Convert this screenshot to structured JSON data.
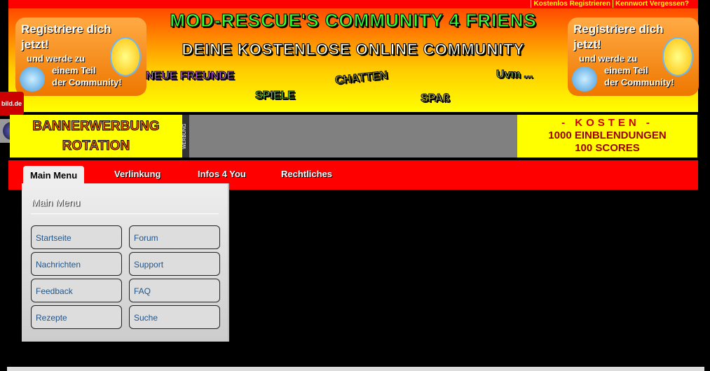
{
  "top_links": [
    "Kostenlos Registrieren",
    "Kennwort Vergessen?"
  ],
  "banner": {
    "title": "MOD-RESCUE'S COMMUNITY 4 FRIENS",
    "subtitle": "DEINE KOSTENLOSE ONLINE COMMUNITY",
    "register": {
      "line1": "Registriere dich jetzt!",
      "line2": "und werde zu",
      "line3": "einem Teil",
      "line4": "der Community!"
    },
    "words": [
      "NEUE FREUNDE",
      "CHATTEN",
      "Uvm ...",
      "SPIELE",
      "SPAß"
    ]
  },
  "side_badges": [
    "bild.de",
    "globe"
  ],
  "ad": {
    "left_line1": "BANNERWERBUNG",
    "left_line2": "ROTATION",
    "vertical": "WERBUNG",
    "right_line1": "- KOSTEN -",
    "right_line2": "1000 EINBLENDUNGEN",
    "right_line3": "100 SCORES"
  },
  "nav": {
    "tabs": [
      "Main Menu",
      "Verlinkung",
      "Infos 4 You",
      "Rechtliches"
    ]
  },
  "dropdown": {
    "title": "Main Menu",
    "items": [
      "Startseite",
      "Forum",
      "Nachrichten",
      "Support",
      "Feedback",
      "FAQ",
      "Rezepte",
      "Suche"
    ]
  }
}
